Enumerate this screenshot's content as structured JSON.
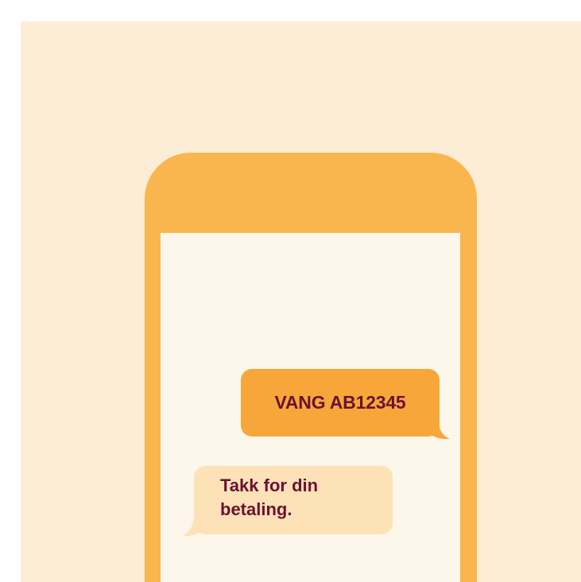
{
  "messages": {
    "sent": {
      "text": "VANG AB12345",
      "color": "#f7a73a"
    },
    "received": {
      "line1": "Takk for din",
      "line2": "betaling.",
      "color": "#fde2b7"
    }
  },
  "colors": {
    "background": "#fdedd6",
    "phone": "#f9b64e",
    "screen": "#fdf6ea",
    "text": "#6b1133"
  }
}
